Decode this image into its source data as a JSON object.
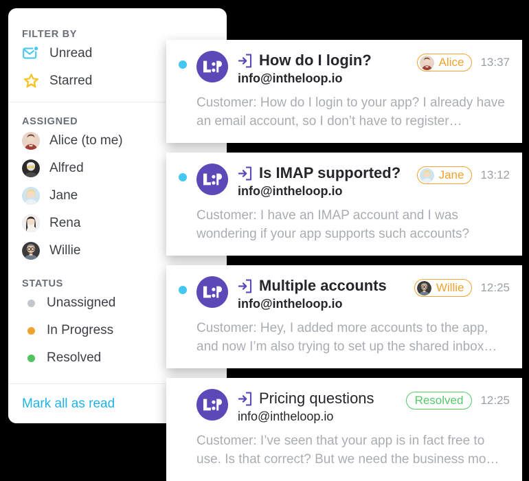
{
  "sidebar": {
    "sections": [
      {
        "heading": "FILTER BY",
        "items": [
          {
            "label": "Unread",
            "icon": "envelope-unread-icon"
          },
          {
            "label": "Starred",
            "icon": "star-icon"
          }
        ]
      },
      {
        "heading": "ASSIGNED",
        "items": [
          {
            "label": "Alice (to me)",
            "icon": "avatar-alice"
          },
          {
            "label": "Alfred",
            "icon": "avatar-alfred"
          },
          {
            "label": "Jane",
            "icon": "avatar-jane"
          },
          {
            "label": "Rena",
            "icon": "avatar-rena"
          },
          {
            "label": "Willie",
            "icon": "avatar-willie"
          }
        ]
      },
      {
        "heading": "STATUS",
        "items": [
          {
            "label": "Unassigned",
            "icon": "status-dot-gray",
            "color": "#c3c6ca"
          },
          {
            "label": "In Progress",
            "icon": "status-dot-orange",
            "color": "#f0a22e"
          },
          {
            "label": "Resolved",
            "icon": "status-dot-green",
            "color": "#52c45f"
          }
        ]
      }
    ],
    "footer_link": "Mark all as read"
  },
  "messages": [
    {
      "unread": true,
      "brand_icon": "loop-logo-icon",
      "subject_icon": "login-arrow-icon",
      "subject": "How do I login?",
      "email": "info@intheloop.io",
      "badge": {
        "type": "assignee",
        "label": "Alice",
        "avatar": "avatar-alice",
        "color": "#f0a22e"
      },
      "time": "13:37",
      "preview": "Customer: How do I login to your app? I already have an email account, so I don’t have to register…"
    },
    {
      "unread": true,
      "brand_icon": "loop-logo-icon",
      "subject_icon": "login-arrow-icon",
      "subject": "Is IMAP supported?",
      "email": "info@intheloop.io",
      "badge": {
        "type": "assignee",
        "label": "Jane",
        "avatar": "avatar-jane",
        "color": "#f0a22e"
      },
      "time": "13:12",
      "preview": "Customer: I have an IMAP account and I was wondering if your app supports such accounts?"
    },
    {
      "unread": true,
      "brand_icon": "loop-logo-icon",
      "subject_icon": "login-arrow-icon",
      "subject": "Multiple accounts",
      "email": "info@intheloop.io",
      "badge": {
        "type": "assignee",
        "label": "Willie",
        "avatar": "avatar-willie",
        "color": "#f0a22e"
      },
      "time": "12:25",
      "preview": "Customer: Hey, I added more accounts to the app, and now I’m also trying to set up the shared inbox…"
    },
    {
      "unread": false,
      "brand_icon": "loop-logo-icon",
      "subject_icon": "login-arrow-icon",
      "subject": "Pricing questions",
      "email": "info@intheloop.io",
      "badge": {
        "type": "status",
        "label": "Resolved",
        "color": "#56c96a"
      },
      "time": "12:25",
      "preview": "Customer: I’ve seen that your app is in fact free to use. Is that correct? But we need the business mo…"
    }
  ],
  "colors": {
    "brand_purple": "#5d48b8",
    "unread_blue": "#44c8f2",
    "link_blue": "#20b3e8",
    "star_yellow": "#f7c325",
    "envelope_cyan": "#4ec9f0"
  }
}
